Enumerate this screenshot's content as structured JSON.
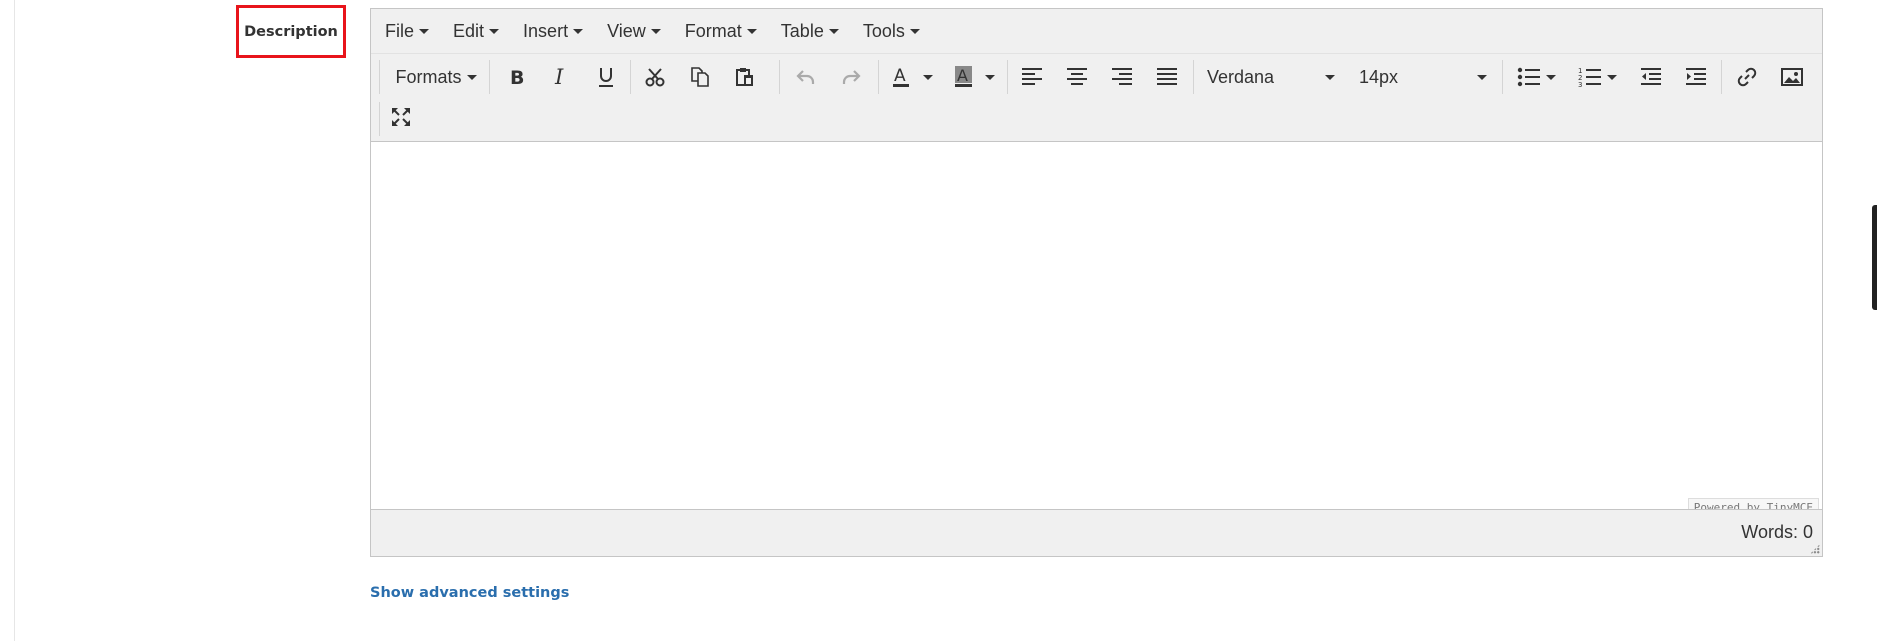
{
  "field": {
    "label": "Description"
  },
  "menubar": [
    {
      "label": "File"
    },
    {
      "label": "Edit"
    },
    {
      "label": "Insert"
    },
    {
      "label": "View"
    },
    {
      "label": "Format"
    },
    {
      "label": "Table"
    },
    {
      "label": "Tools"
    }
  ],
  "toolbar": {
    "formats_label": "Formats",
    "font_family": "Verdana",
    "font_size": "14px"
  },
  "editor": {
    "content": "",
    "powered_by": "Powered by TinyMCE",
    "word_count": "Words: 0"
  },
  "advanced_link": "Show advanced settings",
  "colors": {
    "accent_red": "#e8141b",
    "link_blue": "#2a6ead",
    "toolbar_bg": "#f0f0f0"
  }
}
